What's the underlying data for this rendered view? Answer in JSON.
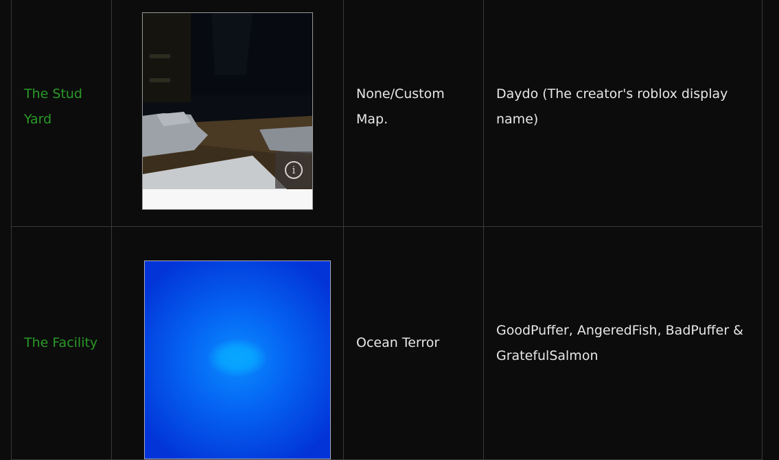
{
  "rows": [
    {
      "name": "The Stud Yard",
      "enemies": "None/Custom Map.",
      "creator": "Daydo (The creator's roblox display name)"
    },
    {
      "name": "The Facility",
      "enemies": "Ocean Terror",
      "creator": "GoodPuffer, AngeredFish, BadPuffer & GratefulSalmon"
    }
  ],
  "icons": {
    "info": "info-icon"
  },
  "colors": {
    "link": "#2a9a27",
    "background": "#0c0c0c",
    "border": "#3a3a3a"
  }
}
